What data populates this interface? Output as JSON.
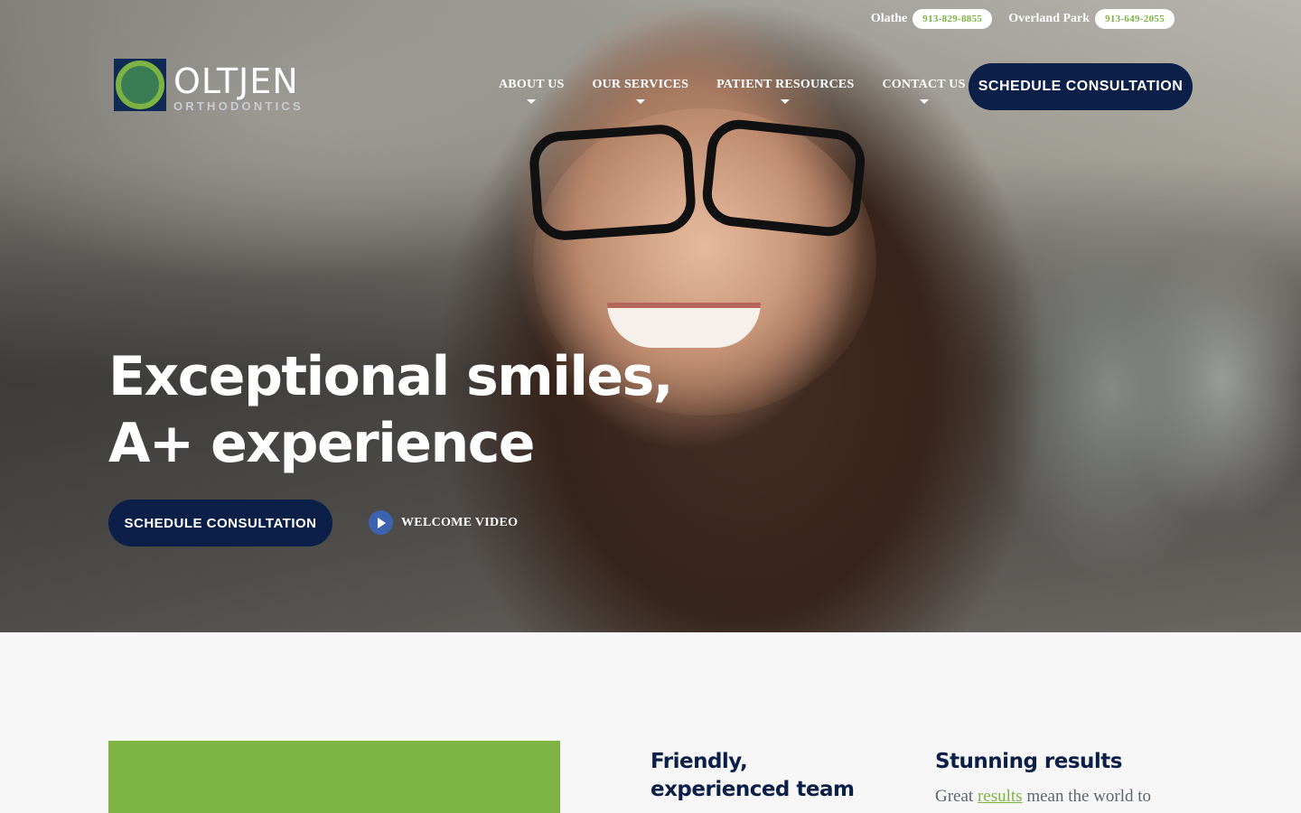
{
  "top_bar": {
    "locations": [
      {
        "name": "Olathe",
        "phone": "913-829-8855"
      },
      {
        "name": "Overland Park",
        "phone": "913-649-2055"
      }
    ]
  },
  "logo": {
    "name": "OLTJEN",
    "sub": "ORTHODONTICS"
  },
  "nav": {
    "items": [
      {
        "label": "ABOUT US"
      },
      {
        "label": "OUR SERVICES"
      },
      {
        "label": "PATIENT RESOURCES"
      },
      {
        "label": "CONTACT US"
      }
    ],
    "cta_label": "SCHEDULE CONSULTATION"
  },
  "hero": {
    "headline_line1": "Exceptional smiles,",
    "headline_line2": "A+ experience",
    "cta_label": "SCHEDULE CONSULTATION",
    "video_label": "WELCOME VIDEO"
  },
  "features": [
    {
      "title": "Friendly, experienced team",
      "text": ""
    },
    {
      "title": "Stunning results",
      "text_before": "Great ",
      "link": "results",
      "text_after": " mean the world to"
    }
  ],
  "colors": {
    "navy": "#0c1f48",
    "green": "#7cb342",
    "background": "#f7f7f7"
  }
}
